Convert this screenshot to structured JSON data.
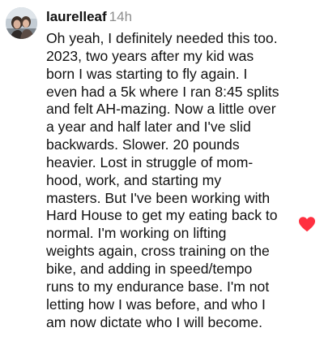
{
  "comment": {
    "username": "laurelleaf",
    "timestamp": "14h",
    "lines": [
      "Oh yeah, I definitely needed this too.",
      "2023, two years after my kid was",
      "born I was starting to fly again. I",
      "even had a 5k where I ran 8:45 splits",
      "and felt AH-mazing. Now a little over",
      "a year and half later and I've slid",
      "backwards. Slower. 20 pounds",
      "heavier. Lost in struggle of mom-",
      "hood, work, and starting my",
      "masters. But I've been working with",
      "Hard House to get my eating back to",
      "normal. I'm working on lifting",
      "weights again, cross training on the",
      "bike, and adding in speed/tempo",
      "runs to my endurance base. I'm not",
      "letting how I was before, and who I",
      "am now dictate who I will become."
    ],
    "liked": true,
    "like_icon": "heart-filled-icon",
    "like_color": "#ff3040",
    "avatar_icon": "profile-photo"
  }
}
